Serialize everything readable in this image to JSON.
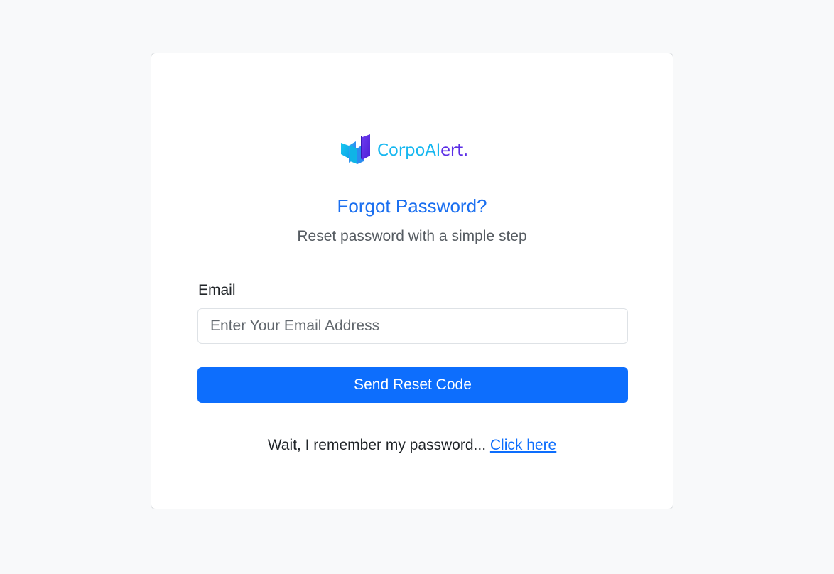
{
  "brand": {
    "name_part1": "CorpoAl",
    "name_part2": "ert.",
    "colors": {
      "primary_cyan": "#16b7f0",
      "primary_violet": "#5b2ee6"
    }
  },
  "form": {
    "title": "Forgot Password?",
    "subtitle": "Reset password with a simple step",
    "email_label": "Email",
    "email_value": "",
    "email_placeholder": "Enter Your Email Address",
    "submit_label": "Send Reset Code"
  },
  "footer": {
    "prompt": "Wait, I remember my password... ",
    "link_label": "Click here"
  },
  "colors": {
    "page_background": "#f8f9fa",
    "accent": "#0d6efd",
    "title": "#1a6ff0"
  },
  "icons": {
    "logo": "corpoalert-logo-icon"
  }
}
